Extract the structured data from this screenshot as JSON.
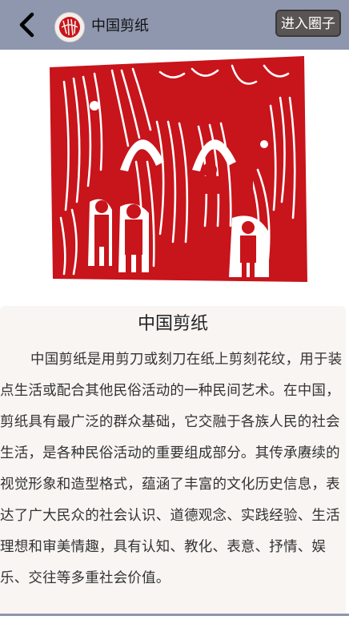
{
  "header": {
    "title": "中国剪纸",
    "join_label": "进入圈子"
  },
  "article": {
    "title": "中国剪纸",
    "body": "中国剪纸是用剪刀或刻刀在纸上剪刻花纹，用于装点生活或配合其他民俗活动的一种民间艺术。在中国，剪纸具有最广泛的群众基础，它交融于各族人民的社会生活，是各种民俗活动的重要组成部分。其传承赓续的视觉形象和造型格式，蕴涵了丰富的文化历史信息，表达了广大民众的社会认识、道德观念、实践经验、生活理想和审美情趣，具有认知、教化、表意、抒情、娱乐、交往等多重社会价值。"
  },
  "icons": {
    "back": "chevron-left-icon",
    "avatar": "papercut-avatar"
  },
  "colors": {
    "header_bg": "#8e97ae",
    "papercut_red": "#c8141b",
    "card_bg": "#f8f5f3",
    "join_button_bg": "#5a5555"
  }
}
